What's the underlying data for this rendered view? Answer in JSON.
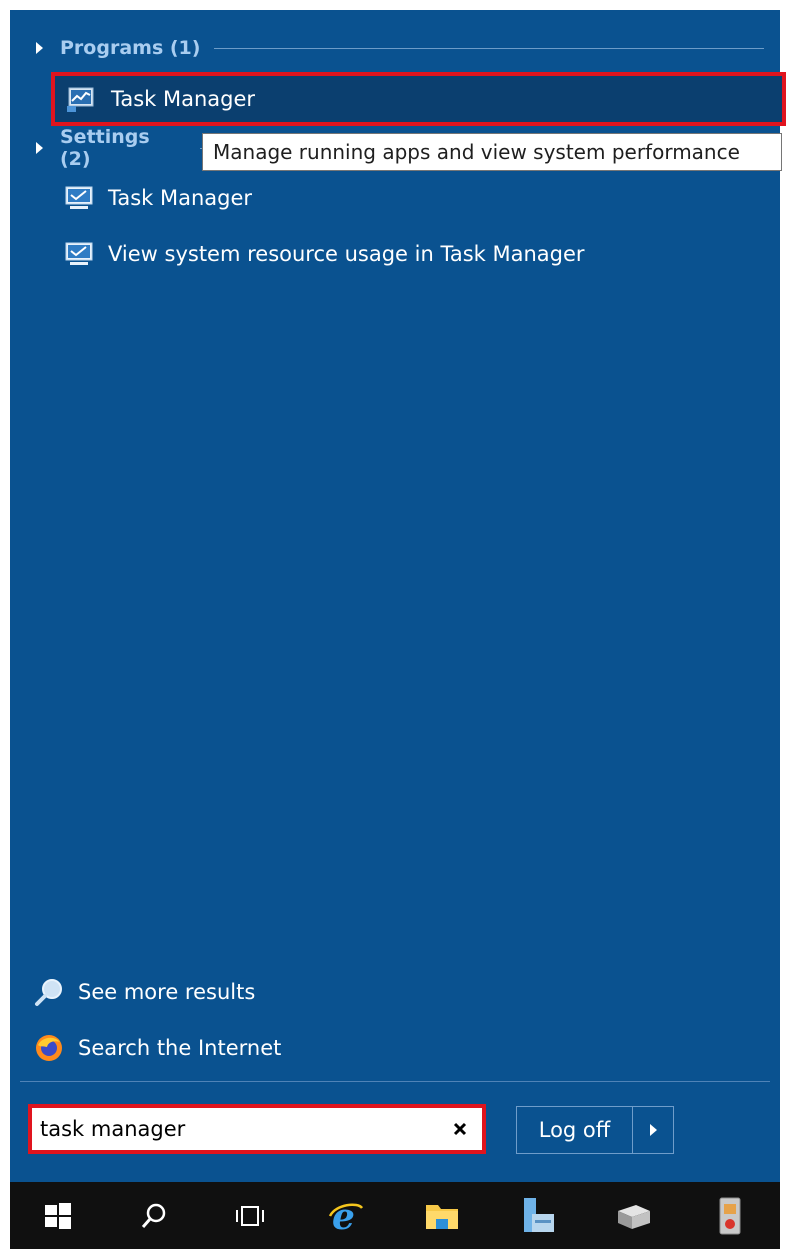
{
  "programs": {
    "header": "Programs (1)",
    "items": [
      {
        "label": "Task Manager",
        "icon": "task-manager-icon"
      }
    ]
  },
  "settings": {
    "header": "Settings (2)",
    "items": [
      {
        "label": "Task Manager",
        "icon": "monitor-settings-icon"
      },
      {
        "label": "View system resource usage in Task Manager",
        "icon": "monitor-settings-icon"
      }
    ]
  },
  "tooltip": "Manage running apps and view system performance",
  "links": {
    "see_more": "See more results",
    "search_internet": "Search the Internet"
  },
  "search": {
    "value": "task manager",
    "placeholder": ""
  },
  "power": {
    "logoff_label": "Log off"
  },
  "taskbar": {
    "items": [
      "windows-start-icon",
      "search-icon",
      "task-view-icon",
      "internet-explorer-icon",
      "file-explorer-icon",
      "server-manager-icon",
      "network-icon",
      "security-icon"
    ]
  },
  "colors": {
    "menu_background": "#0a5290",
    "highlight_border": "#e0141e",
    "group_header": "#a9cdf0",
    "taskbar": "#101010"
  }
}
